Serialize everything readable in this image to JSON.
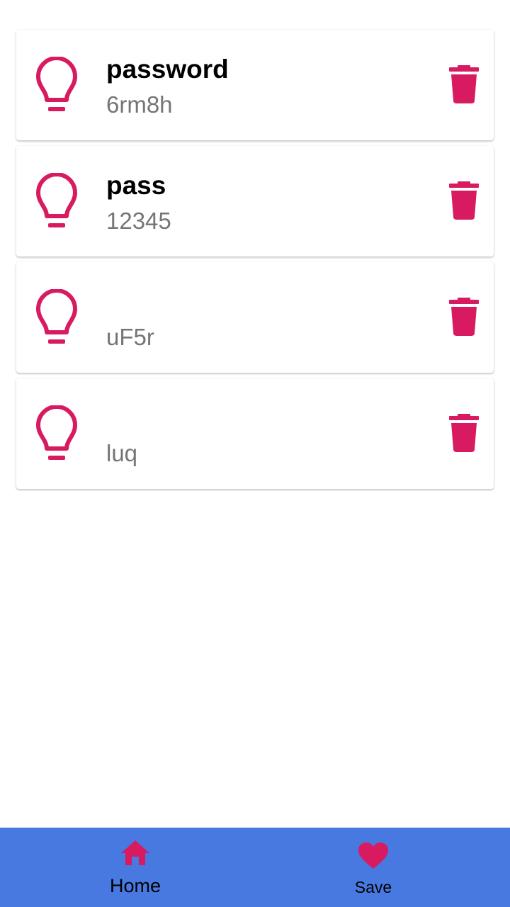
{
  "colors": {
    "accent": "#d81b60",
    "nav_background": "#4779e0",
    "secondary_text": "#757575"
  },
  "entries": [
    {
      "title": "password",
      "value": "6rm8h",
      "icon": "lightbulb-icon",
      "action_icon": "trash-icon"
    },
    {
      "title": "pass",
      "value": "12345",
      "icon": "lightbulb-icon",
      "action_icon": "trash-icon"
    },
    {
      "title": "",
      "value": "uF5r",
      "icon": "lightbulb-icon",
      "action_icon": "trash-icon"
    },
    {
      "title": "",
      "value": "luq",
      "icon": "lightbulb-icon",
      "action_icon": "trash-icon"
    }
  ],
  "bottom_nav": {
    "items": [
      {
        "label": "Home",
        "icon": "home-icon",
        "active": true
      },
      {
        "label": "Save",
        "icon": "heart-icon",
        "active": false
      }
    ]
  }
}
